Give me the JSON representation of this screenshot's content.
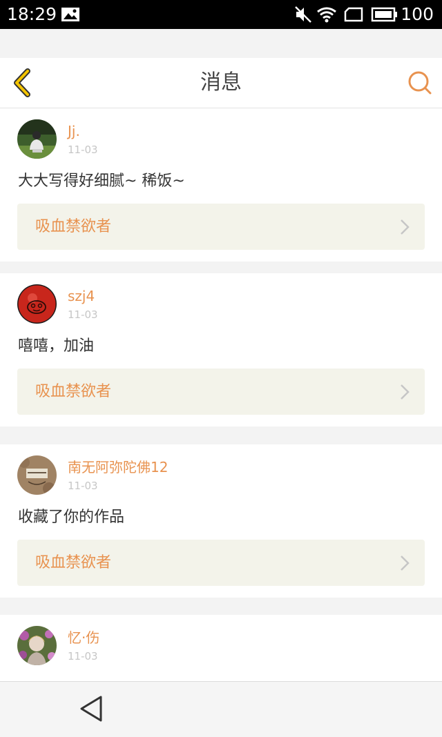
{
  "status_bar": {
    "time": "18:29",
    "battery": "100",
    "icons": [
      "image-icon",
      "mute-icon",
      "wifi-icon",
      "sim-icon",
      "battery-icon"
    ]
  },
  "header": {
    "title": "消息",
    "back_icon": "back-chevron-icon",
    "search_icon": "search-icon"
  },
  "colors": {
    "accent": "#e8924f",
    "back_icon_yellow": "#f4c400",
    "ref_box_bg": "#f3f3ea"
  },
  "messages": [
    {
      "username": "Jj.",
      "date": "11-03",
      "content": "大大写得好细腻~ 稀饭~",
      "reference": "吸血禁欲者",
      "avatar": "person-sitting-on-grass"
    },
    {
      "username": "szj4",
      "date": "11-03",
      "content": "嘻嘻，加油",
      "reference": "吸血禁欲者",
      "avatar": "red-cartoon-face"
    },
    {
      "username": "南无阿弥陀佛12",
      "date": "11-03",
      "content": "收藏了你的作品",
      "reference": "吸血禁欲者",
      "avatar": "forever-card"
    },
    {
      "username": "忆·伤",
      "date": "11-03",
      "avatar": "girl-with-flowers"
    }
  ],
  "nav_bar": {
    "back_icon": "nav-back-triangle-icon"
  }
}
